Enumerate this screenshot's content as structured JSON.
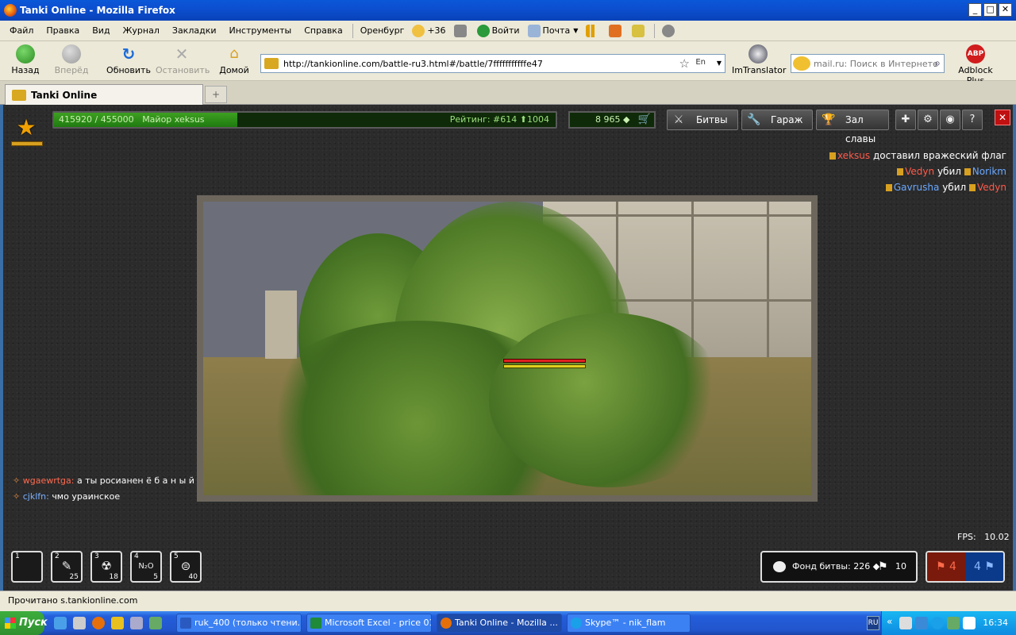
{
  "window": {
    "title": "Tanki Online - Mozilla Firefox"
  },
  "menu": {
    "items": [
      "Файл",
      "Правка",
      "Вид",
      "Журнал",
      "Закладки",
      "Инструменты",
      "Справка"
    ],
    "city": "Оренбург",
    "temperature": "+36",
    "login": "Войти",
    "mail": "Почта"
  },
  "nav": {
    "back": "Назад",
    "forward": "Вперёд",
    "reload": "Обновить",
    "stop": "Остановить",
    "home": "Домой",
    "url": "http://tankionline.com/battle-ru3.html#/battle/7fffffffffffe47",
    "lang_badge": "En",
    "translator": "ImTranslator",
    "search_placeholder": "mail.ru: Поиск в Интернете",
    "adblock": "Adblock Plus",
    "adblock_badge": "ABP"
  },
  "tabs": {
    "active": "Tanki Online",
    "new_tab": "+"
  },
  "game": {
    "xp_text": "415920 / 455000",
    "rank_name": "Майор xeksus",
    "xp_fraction": 0.914,
    "rating": "Рейтинг: #614",
    "rating_delta": "1004",
    "crystals": "8 965",
    "buttons": {
      "battles": "Битвы",
      "garage": "Гараж",
      "hall_of_fame": "Зал славы"
    },
    "killfeed": [
      {
        "a": "xeksus",
        "a_team": "red",
        "verb": "доставил вражеский флаг",
        "b": "",
        "b_team": ""
      },
      {
        "a": "Vedyn",
        "a_team": "red",
        "verb": "убил",
        "b": "Norikm",
        "b_team": "blue"
      },
      {
        "a": "Gavrusha",
        "a_team": "blue",
        "verb": "убил",
        "b": "Vedyn",
        "b_team": "red"
      }
    ],
    "chat": [
      {
        "nick": "wgaewrtga:",
        "team": "red",
        "msg": "а ты росианен ё б а н ы й"
      },
      {
        "nick": "cjklfn:",
        "team": "blue",
        "msg": "чмо ураинское"
      }
    ],
    "fps_label": "FPS:",
    "fps_value": "10.02",
    "slots": [
      {
        "num": "1",
        "count": ""
      },
      {
        "num": "2",
        "count": "25"
      },
      {
        "num": "3",
        "count": "18"
      },
      {
        "num": "4",
        "count": "5"
      },
      {
        "num": "5",
        "count": "40"
      }
    ],
    "fund_label": "Фонд битвы: 226",
    "fund_flags": "10",
    "score_red": "4",
    "score_blue": "4"
  },
  "status": "Прочитано s.tankionline.com",
  "taskbar": {
    "start": "Пуск",
    "tasks": [
      "ruk_400 (только чтени...",
      "Microsoft Excel - price 01...",
      "Tanki Online - Mozilla ...",
      "Skype™ - nik_flam"
    ],
    "lang": "RU",
    "clock": "16:34"
  }
}
